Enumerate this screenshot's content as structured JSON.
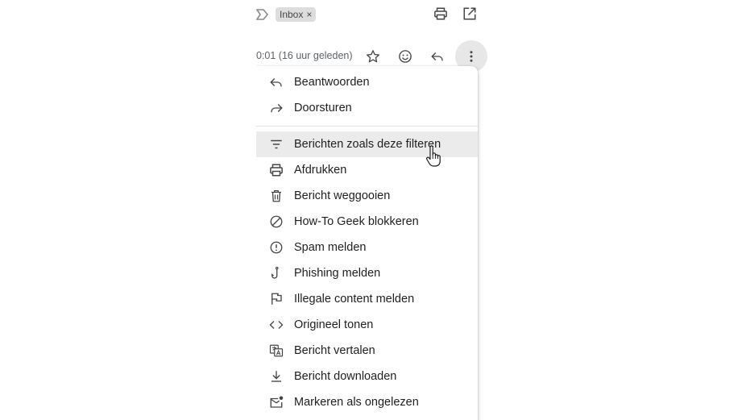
{
  "toolbar": {
    "label_chip": "Inbox",
    "label_chip_remove": "×",
    "print_icon": "print-icon",
    "open_new_window_icon": "open-in-new-icon"
  },
  "message_header": {
    "timestamp": "0:01 (16 uur geleden)",
    "star_icon": "star-icon",
    "emoji_icon": "emoji-icon",
    "reply_icon": "reply-icon",
    "more_icon": "more-vert-icon"
  },
  "menu": {
    "items": [
      {
        "label": "Beantwoorden",
        "icon": "reply-icon"
      },
      {
        "label": "Doorsturen",
        "icon": "forward-icon"
      },
      {
        "label": "Berichten zoals deze filteren",
        "icon": "filter-icon"
      },
      {
        "label": "Afdrukken",
        "icon": "print-icon"
      },
      {
        "label": "Bericht weggooien",
        "icon": "trash-icon"
      },
      {
        "label": "How-To Geek blokkeren",
        "icon": "block-icon"
      },
      {
        "label": "Spam melden",
        "icon": "spam-icon"
      },
      {
        "label": "Phishing melden",
        "icon": "phishing-hook-icon"
      },
      {
        "label": "Illegale content melden",
        "icon": "flag-icon"
      },
      {
        "label": "Origineel tonen",
        "icon": "code-icon"
      },
      {
        "label": "Bericht vertalen",
        "icon": "translate-icon"
      },
      {
        "label": "Bericht downloaden",
        "icon": "download-icon"
      },
      {
        "label": "Markeren als ongelezen",
        "icon": "mark-unread-icon"
      }
    ],
    "hovered_index": 2
  },
  "colors": {
    "icon": "#444746",
    "text": "#1f1f1f",
    "hover_bg": "#ebebeb",
    "more_button_bg": "#e7e7e7",
    "chip_bg": "#dddddd"
  }
}
